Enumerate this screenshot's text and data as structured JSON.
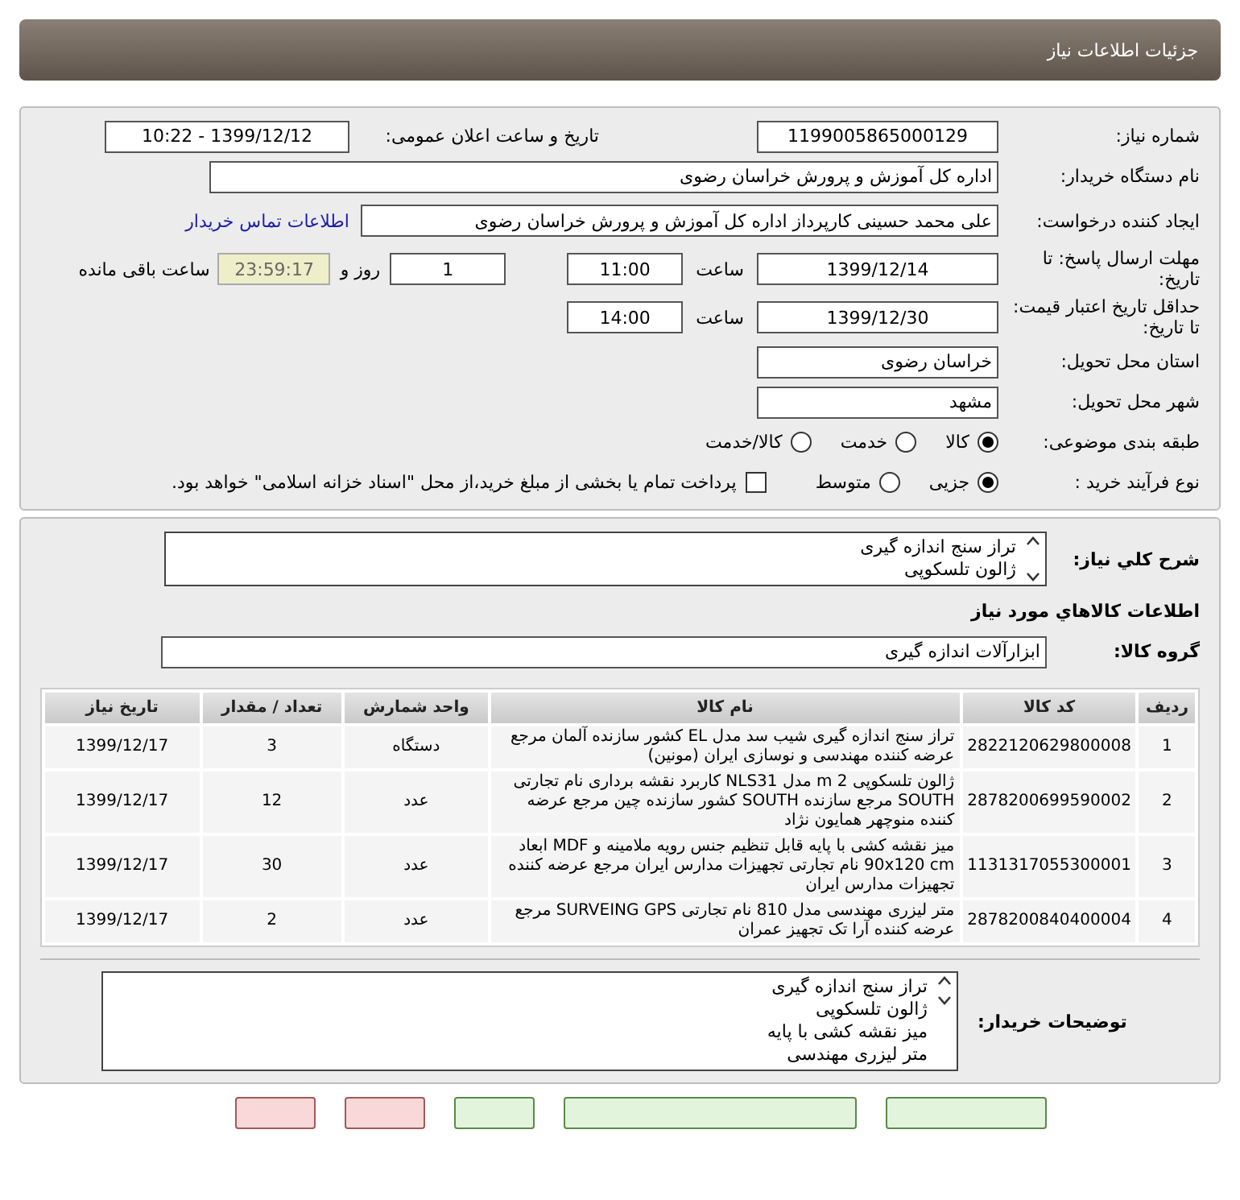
{
  "header": {
    "title": "جزئیات اطلاعات نیاز"
  },
  "details": {
    "need_number": {
      "label": "شماره نیاز:",
      "value": "1199005865000129"
    },
    "announce": {
      "label": "تاریخ و ساعت اعلان عمومی:",
      "value": "1399/12/12 - 10:22"
    },
    "buyer_org": {
      "label": "نام دستگاه خریدار:",
      "value": "اداره کل آموزش و پرورش خراسان رضوی"
    },
    "creator": {
      "label": "ایجاد کننده درخواست:",
      "value": "علی محمد حسینی کارپرداز اداره کل آموزش و پرورش خراسان رضوی",
      "link": "اطلاعات تماس خریدار"
    },
    "deadline": {
      "label": "مهلت ارسال پاسخ: تا تاریخ:",
      "date": "1399/12/14",
      "time_label": "ساعت",
      "time": "11:00",
      "days": "1",
      "days_label": "روز و",
      "remaining": "23:59:17",
      "remaining_label": "ساعت باقی مانده"
    },
    "validity": {
      "label": "حداقل تاریخ اعتبار قیمت: تا تاریخ:",
      "date": "1399/12/30",
      "time_label": "ساعت",
      "time": "14:00"
    },
    "province": {
      "label": "استان محل تحویل:",
      "value": "خراسان رضوی"
    },
    "city": {
      "label": "شهر محل تحویل:",
      "value": "مشهد"
    },
    "category": {
      "label": "طبقه بندی موضوعی:",
      "options": [
        {
          "label": "کالا",
          "selected": true
        },
        {
          "label": "خدمت",
          "selected": false
        },
        {
          "label": "کالا/خدمت",
          "selected": false
        }
      ]
    },
    "process": {
      "label": "نوع فرآیند خرید :",
      "options": [
        {
          "label": "جزیی",
          "selected": true
        },
        {
          "label": "متوسط",
          "selected": false
        }
      ],
      "payment": {
        "label": "پرداخت تمام یا بخشی از مبلغ خرید،از محل \"اسناد خزانه اسلامی\" خواهد بود.",
        "checked": false
      }
    }
  },
  "summary": {
    "label": "شرح كلي نياز:",
    "lines": [
      "تراز سنج اندازه گیری",
      "ژالون تلسکوپی"
    ]
  },
  "goods_heading": "اطلاعات كالاهاي مورد نياز",
  "goods_group": {
    "label": "گروه کالا:",
    "value": "ابزارآلات اندازه گیری"
  },
  "table": {
    "columns": [
      "ردیف",
      "کد کالا",
      "نام کالا",
      "واحد شمارش",
      "تعداد / مقدار",
      "تاریخ نیاز"
    ],
    "rows": [
      {
        "index": "1",
        "code": "2822120629800008",
        "name": "تراز سنج اندازه گیری شیب سد مدل EL کشور سازنده آلمان مرجع عرضه کننده مهندسی و نوسازی ایران (مونین)",
        "unit": "دستگاه",
        "qty": "3",
        "date": "1399/12/17"
      },
      {
        "index": "2",
        "code": "2878200699590002",
        "name": "ژالون تلسکوپی m 2 مدل NLS31 کاربرد نقشه برداری نام تجارتی SOUTH مرجع سازنده SOUTH کشور سازنده چین مرجع عرضه کننده منوچهر همایون نژاد",
        "unit": "عدد",
        "qty": "12",
        "date": "1399/12/17"
      },
      {
        "index": "3",
        "code": "1131317055300001",
        "name": "میز نقشه کشی با پایه قابل تنظیم جنس رویه ملامینه و MDF ابعاد 90x120 cm نام تجارتی تجهیزات مدارس ایران مرجع عرضه کننده تجهیزات مدارس ایران",
        "unit": "عدد",
        "qty": "30",
        "date": "1399/12/17"
      },
      {
        "index": "4",
        "code": "2878200840400004",
        "name": "متر لیزری مهندسی مدل 810 نام تجارتی SURVEING GPS مرجع عرضه کننده آرا تک تجهیز عمران",
        "unit": "عدد",
        "qty": "2",
        "date": "1399/12/17"
      }
    ]
  },
  "buyer_notes": {
    "label": "توضیحات خریدار:",
    "lines": [
      "تراز سنج اندازه گیری",
      "ژالون تلسکوپی",
      "میز نقشه کشی با پایه",
      "متر لیزری مهندسی"
    ]
  },
  "footer_buttons": [
    {
      "kind": "green"
    },
    {
      "kind": "green"
    },
    {
      "kind": "green"
    },
    {
      "kind": "pink"
    },
    {
      "kind": "pink"
    }
  ]
}
